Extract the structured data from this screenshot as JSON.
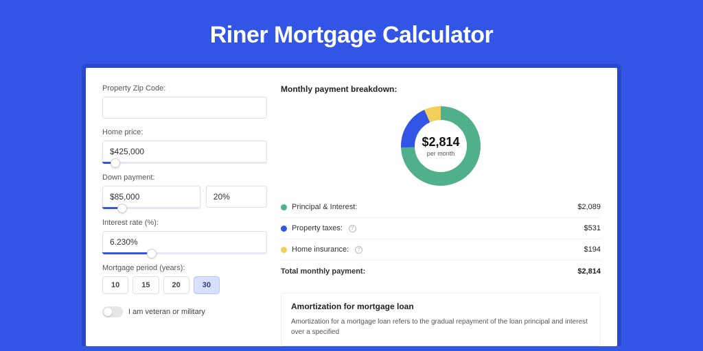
{
  "page_title": "Riner Mortgage Calculator",
  "form": {
    "zip_label": "Property Zip Code:",
    "zip_value": "",
    "home_price_label": "Home price:",
    "home_price_value": "$425,000",
    "down_payment_label": "Down payment:",
    "down_payment_value": "$85,000",
    "down_payment_pct": "20%",
    "interest_label": "Interest rate (%):",
    "interest_value": "6.230%",
    "period_label": "Mortgage period (years):",
    "period_options": [
      "10",
      "15",
      "20",
      "30"
    ],
    "period_selected": "30",
    "veteran_label": "I am veteran or military"
  },
  "breakdown": {
    "title": "Monthly payment breakdown:",
    "center_amount": "$2,814",
    "center_sub": "per month",
    "items": [
      {
        "label": "Principal & Interest:",
        "value": "$2,089",
        "color": "#4fb08a",
        "info": false
      },
      {
        "label": "Property taxes:",
        "value": "$531",
        "color": "#3355e6",
        "info": true
      },
      {
        "label": "Home insurance:",
        "value": "$194",
        "color": "#f2cf5b",
        "info": true
      }
    ],
    "total_label": "Total monthly payment:",
    "total_value": "$2,814"
  },
  "amort": {
    "title": "Amortization for mortgage loan",
    "text": "Amortization for a mortgage loan refers to the gradual repayment of the loan principal and interest over a specified"
  },
  "chart_data": {
    "type": "pie",
    "title": "Monthly payment breakdown",
    "series": [
      {
        "name": "Principal & Interest",
        "value": 2089,
        "color": "#4fb08a"
      },
      {
        "name": "Property taxes",
        "value": 531,
        "color": "#3355e6"
      },
      {
        "name": "Home insurance",
        "value": 194,
        "color": "#f2cf5b"
      }
    ],
    "total": 2814
  },
  "sliders": {
    "home_price_pct": 8,
    "down_payment_pct": 20,
    "interest_pct": 30
  }
}
